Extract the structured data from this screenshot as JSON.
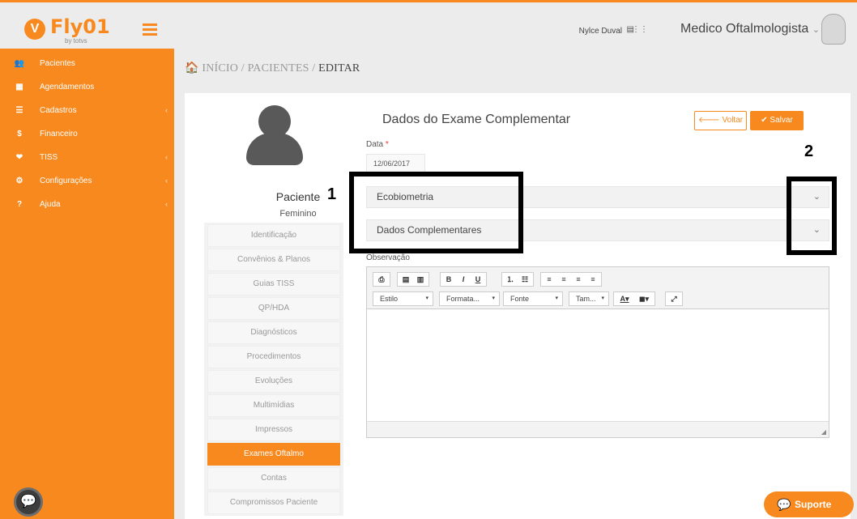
{
  "brand": {
    "logo_letter": "V",
    "name": "Fly01",
    "sub": "by totvs"
  },
  "sidebar": {
    "items": [
      {
        "label": "Pacientes",
        "icon": "users-icon",
        "glyph": "👥",
        "has_chevron": false
      },
      {
        "label": "Agendamentos",
        "icon": "calendar-icon",
        "glyph": "▦",
        "has_chevron": false
      },
      {
        "label": "Cadastros",
        "icon": "list-icon",
        "glyph": "☰",
        "has_chevron": true
      },
      {
        "label": "Financeiro",
        "icon": "dollar-icon",
        "glyph": "$",
        "has_chevron": false
      },
      {
        "label": "TISS",
        "icon": "heart-icon",
        "glyph": "❤",
        "has_chevron": true
      },
      {
        "label": "Configurações",
        "icon": "gear-icon",
        "glyph": "⚙",
        "has_chevron": true
      },
      {
        "label": "Ajuda",
        "icon": "question-icon",
        "glyph": "?",
        "has_chevron": true
      }
    ],
    "chevron": "‹"
  },
  "topbar": {
    "user_name": "Nylce Duval",
    "role": "Medico Oftalmologista",
    "role_caret": "⌄"
  },
  "breadcrumb": {
    "home": "INÍCIO",
    "sep1": "/",
    "section": "PACIENTES",
    "sep2": "/",
    "current": "EDITAR"
  },
  "patient": {
    "label": "Paciente",
    "gender": "Feminino"
  },
  "patient_tabs": [
    {
      "label": "Identificação",
      "active": false
    },
    {
      "label": "Convênios & Planos",
      "active": false
    },
    {
      "label": "Guias TISS",
      "active": false
    },
    {
      "label": "QP/HDA",
      "active": false
    },
    {
      "label": "Diagnósticos",
      "active": false
    },
    {
      "label": "Procedimentos",
      "active": false
    },
    {
      "label": "Evoluções",
      "active": false
    },
    {
      "label": "Multimídias",
      "active": false
    },
    {
      "label": "Impressos",
      "active": false
    },
    {
      "label": "Exames Oftalmo",
      "active": true
    },
    {
      "label": "Contas",
      "active": false
    },
    {
      "label": "Compromissos Paciente",
      "active": false
    }
  ],
  "form": {
    "title": "Dados do Exame Complementar",
    "back_label": "Voltar",
    "save_label": "Salvar",
    "data_label": "Data",
    "required_mark": "*",
    "data_value": "12/06/2017",
    "accordions": [
      {
        "label": "Ecobiometria"
      },
      {
        "label": "Dados Complementares"
      }
    ],
    "observacao_label": "Observação"
  },
  "editor": {
    "selects": [
      {
        "label": "Estilo"
      },
      {
        "label": "Formata..."
      },
      {
        "label": "Fonte"
      },
      {
        "label": "Tam..."
      }
    ],
    "bold": "B",
    "italic": "I",
    "underline": "U"
  },
  "annotations": {
    "one": "1",
    "two": "2"
  },
  "support": {
    "label": "Suporte"
  },
  "colors": {
    "accent": "#f7891f",
    "sidebar": "#f7891f",
    "avatar": "#595959"
  }
}
